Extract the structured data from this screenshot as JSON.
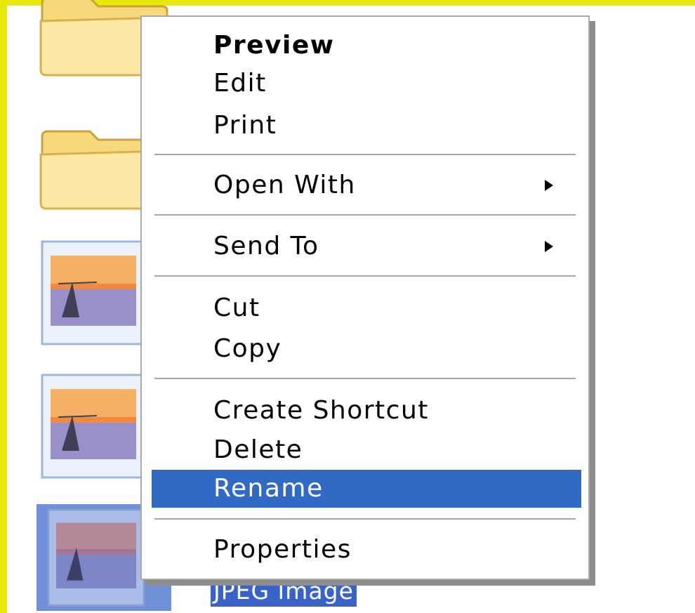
{
  "desktop": {
    "selected_file_label": "JPEG Image",
    "icons": [
      "folder-icon",
      "folder-icon",
      "image-file-icon",
      "image-file-icon",
      "image-file-icon"
    ]
  },
  "context_menu": {
    "items": [
      {
        "label": "Preview",
        "default": true
      },
      {
        "label": "Edit"
      },
      {
        "label": "Print"
      },
      {
        "label": "Open With",
        "submenu": true
      },
      {
        "label": "Send To",
        "submenu": true
      },
      {
        "label": "Cut"
      },
      {
        "label": "Copy"
      },
      {
        "label": "Create Shortcut"
      },
      {
        "label": "Delete"
      },
      {
        "label": "Rename",
        "highlighted": true
      },
      {
        "label": "Properties"
      }
    ]
  },
  "colors": {
    "frame": "#e8e80a",
    "highlight": "#316ac5",
    "selection": "#3a63c9"
  }
}
